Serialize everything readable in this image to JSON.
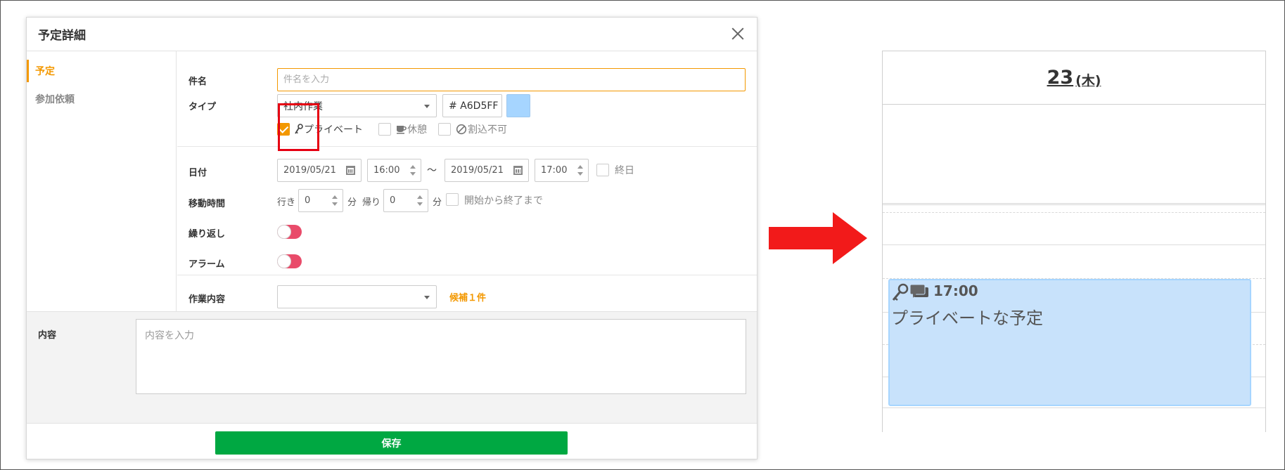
{
  "dialog": {
    "title": "予定詳細",
    "tabs": [
      {
        "label": "予定",
        "active": true
      },
      {
        "label": "参加依頼",
        "active": false
      }
    ],
    "fields": {
      "subject": {
        "label": "件名",
        "placeholder": "件名を入力",
        "value": ""
      },
      "type": {
        "label": "タイプ",
        "selected": "社内作業",
        "color_code": "# A6D5FF",
        "color": "#A6D5FF",
        "flags": [
          {
            "label": "プライベート",
            "checked": true,
            "icon": "key-icon"
          },
          {
            "label": "休憩",
            "checked": false,
            "icon": "coffee-icon"
          },
          {
            "label": "割込不可",
            "checked": false,
            "icon": "no-entry-icon"
          }
        ]
      },
      "date": {
        "label": "日付",
        "start_date": "2019/05/21",
        "start_time": "16:00",
        "separator": "～",
        "end_date": "2019/05/21",
        "end_time": "17:00",
        "all_day_label": "終日",
        "all_day": false
      },
      "travel": {
        "label": "移動時間",
        "go_label": "行き",
        "go_value": "0",
        "return_label": "帰り",
        "return_value": "0",
        "unit": "分",
        "start_to_end_label": "開始から終了まで",
        "start_to_end": false
      },
      "repeat": {
        "label": "繰り返し",
        "on": false
      },
      "alarm": {
        "label": "アラーム",
        "on": false
      },
      "work": {
        "label": "作業内容",
        "selected": "",
        "candidates": "候補１件"
      }
    },
    "content": {
      "label": "内容",
      "placeholder": "内容を入力"
    },
    "save_label": "保存"
  },
  "calendar": {
    "day_number": "23",
    "weekday": "(木)",
    "event": {
      "time": "17:00",
      "title": "プライベートな予定",
      "color": "#A6D5FF",
      "icons": [
        "key-icon",
        "chat-icon"
      ]
    }
  },
  "annotation": {
    "highlight_color": "#E60012",
    "arrow_color": "#E60012"
  }
}
